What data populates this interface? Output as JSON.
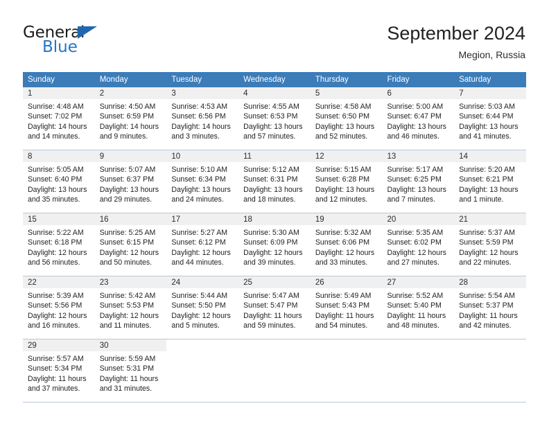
{
  "brand": {
    "name_part1": "General",
    "name_part2": "Blue",
    "triangle_color": "#1f68b0",
    "blue_text_color": "#2176c7"
  },
  "header": {
    "title": "September 2024",
    "subtitle": "Megion, Russia"
  },
  "theme": {
    "header_row_bg": "#3b7cb9",
    "header_row_text": "#ffffff",
    "daynum_band_bg": "#f0f0f0",
    "grid_line": "#b7c9da",
    "body_text": "#222222"
  },
  "weekday_headers": [
    "Sunday",
    "Monday",
    "Tuesday",
    "Wednesday",
    "Thursday",
    "Friday",
    "Saturday"
  ],
  "weeks": [
    [
      {
        "day": "1",
        "sunrise": "Sunrise: 4:48 AM",
        "sunset": "Sunset: 7:02 PM",
        "daylight_line1": "Daylight: 14 hours",
        "daylight_line2": "and 14 minutes."
      },
      {
        "day": "2",
        "sunrise": "Sunrise: 4:50 AM",
        "sunset": "Sunset: 6:59 PM",
        "daylight_line1": "Daylight: 14 hours",
        "daylight_line2": "and 9 minutes."
      },
      {
        "day": "3",
        "sunrise": "Sunrise: 4:53 AM",
        "sunset": "Sunset: 6:56 PM",
        "daylight_line1": "Daylight: 14 hours",
        "daylight_line2": "and 3 minutes."
      },
      {
        "day": "4",
        "sunrise": "Sunrise: 4:55 AM",
        "sunset": "Sunset: 6:53 PM",
        "daylight_line1": "Daylight: 13 hours",
        "daylight_line2": "and 57 minutes."
      },
      {
        "day": "5",
        "sunrise": "Sunrise: 4:58 AM",
        "sunset": "Sunset: 6:50 PM",
        "daylight_line1": "Daylight: 13 hours",
        "daylight_line2": "and 52 minutes."
      },
      {
        "day": "6",
        "sunrise": "Sunrise: 5:00 AM",
        "sunset": "Sunset: 6:47 PM",
        "daylight_line1": "Daylight: 13 hours",
        "daylight_line2": "and 46 minutes."
      },
      {
        "day": "7",
        "sunrise": "Sunrise: 5:03 AM",
        "sunset": "Sunset: 6:44 PM",
        "daylight_line1": "Daylight: 13 hours",
        "daylight_line2": "and 41 minutes."
      }
    ],
    [
      {
        "day": "8",
        "sunrise": "Sunrise: 5:05 AM",
        "sunset": "Sunset: 6:40 PM",
        "daylight_line1": "Daylight: 13 hours",
        "daylight_line2": "and 35 minutes."
      },
      {
        "day": "9",
        "sunrise": "Sunrise: 5:07 AM",
        "sunset": "Sunset: 6:37 PM",
        "daylight_line1": "Daylight: 13 hours",
        "daylight_line2": "and 29 minutes."
      },
      {
        "day": "10",
        "sunrise": "Sunrise: 5:10 AM",
        "sunset": "Sunset: 6:34 PM",
        "daylight_line1": "Daylight: 13 hours",
        "daylight_line2": "and 24 minutes."
      },
      {
        "day": "11",
        "sunrise": "Sunrise: 5:12 AM",
        "sunset": "Sunset: 6:31 PM",
        "daylight_line1": "Daylight: 13 hours",
        "daylight_line2": "and 18 minutes."
      },
      {
        "day": "12",
        "sunrise": "Sunrise: 5:15 AM",
        "sunset": "Sunset: 6:28 PM",
        "daylight_line1": "Daylight: 13 hours",
        "daylight_line2": "and 12 minutes."
      },
      {
        "day": "13",
        "sunrise": "Sunrise: 5:17 AM",
        "sunset": "Sunset: 6:25 PM",
        "daylight_line1": "Daylight: 13 hours",
        "daylight_line2": "and 7 minutes."
      },
      {
        "day": "14",
        "sunrise": "Sunrise: 5:20 AM",
        "sunset": "Sunset: 6:21 PM",
        "daylight_line1": "Daylight: 13 hours",
        "daylight_line2": "and 1 minute."
      }
    ],
    [
      {
        "day": "15",
        "sunrise": "Sunrise: 5:22 AM",
        "sunset": "Sunset: 6:18 PM",
        "daylight_line1": "Daylight: 12 hours",
        "daylight_line2": "and 56 minutes."
      },
      {
        "day": "16",
        "sunrise": "Sunrise: 5:25 AM",
        "sunset": "Sunset: 6:15 PM",
        "daylight_line1": "Daylight: 12 hours",
        "daylight_line2": "and 50 minutes."
      },
      {
        "day": "17",
        "sunrise": "Sunrise: 5:27 AM",
        "sunset": "Sunset: 6:12 PM",
        "daylight_line1": "Daylight: 12 hours",
        "daylight_line2": "and 44 minutes."
      },
      {
        "day": "18",
        "sunrise": "Sunrise: 5:30 AM",
        "sunset": "Sunset: 6:09 PM",
        "daylight_line1": "Daylight: 12 hours",
        "daylight_line2": "and 39 minutes."
      },
      {
        "day": "19",
        "sunrise": "Sunrise: 5:32 AM",
        "sunset": "Sunset: 6:06 PM",
        "daylight_line1": "Daylight: 12 hours",
        "daylight_line2": "and 33 minutes."
      },
      {
        "day": "20",
        "sunrise": "Sunrise: 5:35 AM",
        "sunset": "Sunset: 6:02 PM",
        "daylight_line1": "Daylight: 12 hours",
        "daylight_line2": "and 27 minutes."
      },
      {
        "day": "21",
        "sunrise": "Sunrise: 5:37 AM",
        "sunset": "Sunset: 5:59 PM",
        "daylight_line1": "Daylight: 12 hours",
        "daylight_line2": "and 22 minutes."
      }
    ],
    [
      {
        "day": "22",
        "sunrise": "Sunrise: 5:39 AM",
        "sunset": "Sunset: 5:56 PM",
        "daylight_line1": "Daylight: 12 hours",
        "daylight_line2": "and 16 minutes."
      },
      {
        "day": "23",
        "sunrise": "Sunrise: 5:42 AM",
        "sunset": "Sunset: 5:53 PM",
        "daylight_line1": "Daylight: 12 hours",
        "daylight_line2": "and 11 minutes."
      },
      {
        "day": "24",
        "sunrise": "Sunrise: 5:44 AM",
        "sunset": "Sunset: 5:50 PM",
        "daylight_line1": "Daylight: 12 hours",
        "daylight_line2": "and 5 minutes."
      },
      {
        "day": "25",
        "sunrise": "Sunrise: 5:47 AM",
        "sunset": "Sunset: 5:47 PM",
        "daylight_line1": "Daylight: 11 hours",
        "daylight_line2": "and 59 minutes."
      },
      {
        "day": "26",
        "sunrise": "Sunrise: 5:49 AM",
        "sunset": "Sunset: 5:43 PM",
        "daylight_line1": "Daylight: 11 hours",
        "daylight_line2": "and 54 minutes."
      },
      {
        "day": "27",
        "sunrise": "Sunrise: 5:52 AM",
        "sunset": "Sunset: 5:40 PM",
        "daylight_line1": "Daylight: 11 hours",
        "daylight_line2": "and 48 minutes."
      },
      {
        "day": "28",
        "sunrise": "Sunrise: 5:54 AM",
        "sunset": "Sunset: 5:37 PM",
        "daylight_line1": "Daylight: 11 hours",
        "daylight_line2": "and 42 minutes."
      }
    ],
    [
      {
        "day": "29",
        "sunrise": "Sunrise: 5:57 AM",
        "sunset": "Sunset: 5:34 PM",
        "daylight_line1": "Daylight: 11 hours",
        "daylight_line2": "and 37 minutes."
      },
      {
        "day": "30",
        "sunrise": "Sunrise: 5:59 AM",
        "sunset": "Sunset: 5:31 PM",
        "daylight_line1": "Daylight: 11 hours",
        "daylight_line2": "and 31 minutes."
      },
      {
        "day": "",
        "sunrise": "",
        "sunset": "",
        "daylight_line1": "",
        "daylight_line2": ""
      },
      {
        "day": "",
        "sunrise": "",
        "sunset": "",
        "daylight_line1": "",
        "daylight_line2": ""
      },
      {
        "day": "",
        "sunrise": "",
        "sunset": "",
        "daylight_line1": "",
        "daylight_line2": ""
      },
      {
        "day": "",
        "sunrise": "",
        "sunset": "",
        "daylight_line1": "",
        "daylight_line2": ""
      },
      {
        "day": "",
        "sunrise": "",
        "sunset": "",
        "daylight_line1": "",
        "daylight_line2": ""
      }
    ]
  ]
}
